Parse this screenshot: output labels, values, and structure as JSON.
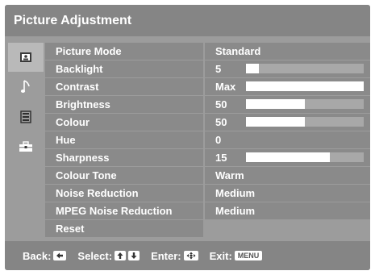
{
  "title": "Picture Adjustment",
  "sidebar": {
    "tabs": [
      {
        "icon": "picture-icon",
        "active": true
      },
      {
        "icon": "music-note-icon",
        "active": false
      },
      {
        "icon": "settings-list-icon",
        "active": false
      },
      {
        "icon": "toolbox-icon",
        "active": false
      }
    ]
  },
  "menu": {
    "rows": [
      {
        "name": "picture-mode",
        "label": "Picture Mode",
        "value": "Standard",
        "level": null
      },
      {
        "name": "backlight",
        "label": "Backlight",
        "value": "5",
        "level": 0.11
      },
      {
        "name": "contrast",
        "label": "Contrast",
        "value": "Max",
        "level": 1.0
      },
      {
        "name": "brightness",
        "label": "Brightness",
        "value": "50",
        "level": 0.5
      },
      {
        "name": "colour",
        "label": "Colour",
        "value": "50",
        "level": 0.5
      },
      {
        "name": "hue",
        "label": "Hue",
        "value": "0",
        "level": null
      },
      {
        "name": "sharpness",
        "label": "Sharpness",
        "value": "15",
        "level": 0.71
      },
      {
        "name": "colour-tone",
        "label": "Colour Tone",
        "value": "Warm",
        "level": null
      },
      {
        "name": "noise-reduction",
        "label": "Noise Reduction",
        "value": "Medium",
        "level": null
      },
      {
        "name": "mpeg-noise-reduction",
        "label": "MPEG Noise Reduction",
        "value": "Medium",
        "level": null
      },
      {
        "name": "reset",
        "label": "Reset",
        "value": "",
        "level": null
      }
    ]
  },
  "footer": {
    "back_label": "Back:",
    "select_label": "Select:",
    "enter_label": "Enter:",
    "exit_label": "Exit:",
    "menu_key": "MENU"
  },
  "colors": {
    "panel": "#9c9c9c",
    "header": "#858585",
    "row": "#8a8a8a",
    "bar_fill": "#ffffff"
  }
}
